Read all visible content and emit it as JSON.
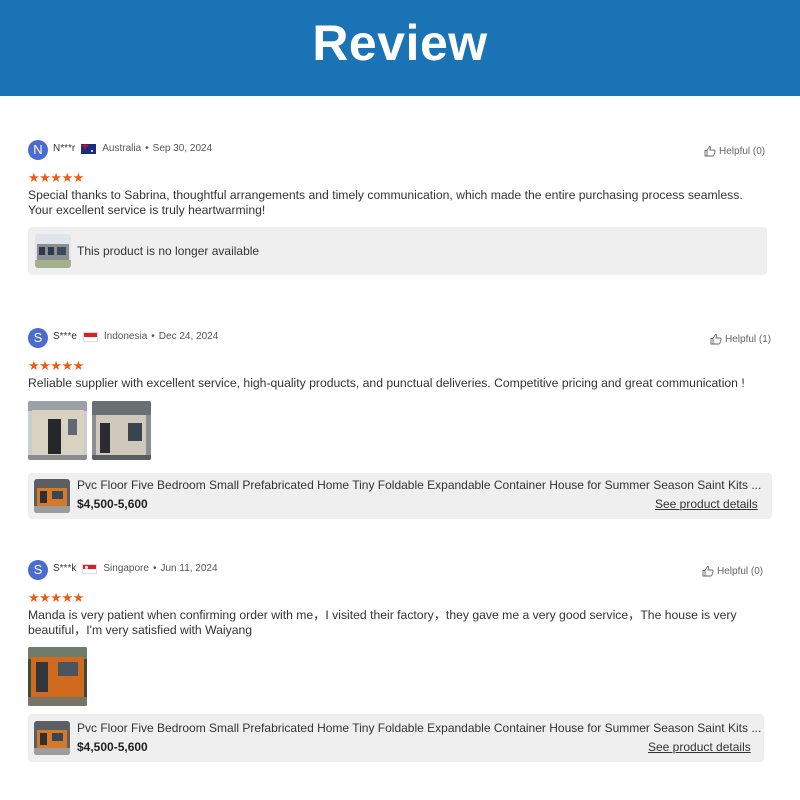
{
  "header": {
    "title": "Review"
  },
  "reviews": [
    {
      "avatar_letter": "N",
      "name": "N***r",
      "country": "Australia",
      "date": "Sep 30, 2024",
      "helpful": "Helpful (0)",
      "stars": "★★★★★",
      "rating": 5,
      "text_line1": "Special thanks to Sabrina,  thoughtful arrangements and timely communication, which made the entire purchasing process seamless.",
      "text_line2": "Your excellent service is truly heartwarming!",
      "unavailable": "This product is no longer available"
    },
    {
      "avatar_letter": "S",
      "name": "S***e",
      "country": "Indonesia",
      "date": "Dec 24, 2024",
      "helpful": "Helpful (1)",
      "stars": "★★★★★",
      "rating": 5,
      "text_line1": "Reliable supplier with excellent service, high-quality products, and punctual deliveries. Competitive pricing and great communication !",
      "product_title": "Pvc Floor Five Bedroom Small Prefabricated Home Tiny Foldable Expandable Container House for Summer Season Saint Kits ...",
      "product_price": "$4,500-5,600",
      "see_details": "See product details"
    },
    {
      "avatar_letter": "S",
      "name": "S***k",
      "country": "Singapore",
      "date": "Jun 11, 2024",
      "helpful": "Helpful (0)",
      "stars": "★★★★★",
      "rating": 5,
      "text_line1": "Manda is very patient when confirming order with me，I visited their factory，they gave me a very good service，The house is very",
      "text_line2": "beautiful，I'm very satisfied with Waiyang",
      "product_title": "Pvc Floor Five Bedroom Small Prefabricated Home Tiny Foldable Expandable Container House for Summer Season Saint Kits ...",
      "product_price": "$4,500-5,600",
      "see_details": "See product details"
    }
  ],
  "colors": {
    "header_bg": "#1a73b4",
    "star": "#f05a14",
    "avatar": "#4a6bd0",
    "card_bg": "#efefef"
  }
}
